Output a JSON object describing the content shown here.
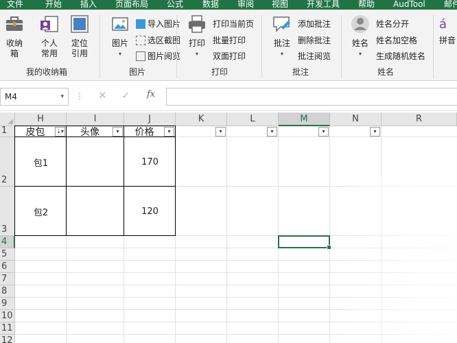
{
  "menu": {
    "tabs": [
      "文件",
      "开始",
      "插入",
      "页面布局",
      "公式",
      "数据",
      "审阅",
      "视图",
      "开发工具",
      "帮助",
      "AudTool",
      "邮件"
    ]
  },
  "ribbon": {
    "mybox": {
      "btn1": "收纳箱",
      "btn2": "个人常用",
      "btn3": "定位引用",
      "label": "我的收纳箱"
    },
    "picture": {
      "big": "图片",
      "items": [
        "导入图片",
        "选区截图",
        "图片阅览"
      ],
      "label": "图片"
    },
    "print": {
      "big": "打印",
      "items": [
        "打印当前页",
        "批量打印",
        "双面打印"
      ],
      "label": "打印"
    },
    "comment": {
      "big": "批注",
      "items": [
        "添加批注",
        "删除批注",
        "批注阅览"
      ],
      "label": "批注"
    },
    "name": {
      "big": "姓名",
      "items": [
        "姓名分开",
        "姓名加空格",
        "生成随机姓名"
      ],
      "label": "姓名"
    },
    "pinyin": {
      "big": "拼音",
      "label": "拼音"
    }
  },
  "formula_bar": {
    "name_box": "M4",
    "fx": "fx",
    "value": ""
  },
  "sheet": {
    "columns": [
      "H",
      "I",
      "J",
      "K",
      "L",
      "M",
      "N",
      "R"
    ],
    "active_column": "M",
    "rows": [
      "1",
      "2",
      "3",
      "4",
      "5",
      "6",
      "7",
      "8",
      "9",
      "10",
      "11",
      "12"
    ],
    "active_row": "4",
    "headers": [
      "皮包",
      "头像",
      "价格"
    ],
    "data": [
      {
        "bag": "包1",
        "avatar": "",
        "price": "170"
      },
      {
        "bag": "包2",
        "avatar": "",
        "price": "120"
      }
    ]
  },
  "colors": {
    "accent": "#217346",
    "ribbon_bg": "#f3f3f3",
    "header_bg": "#e6e6e6"
  }
}
